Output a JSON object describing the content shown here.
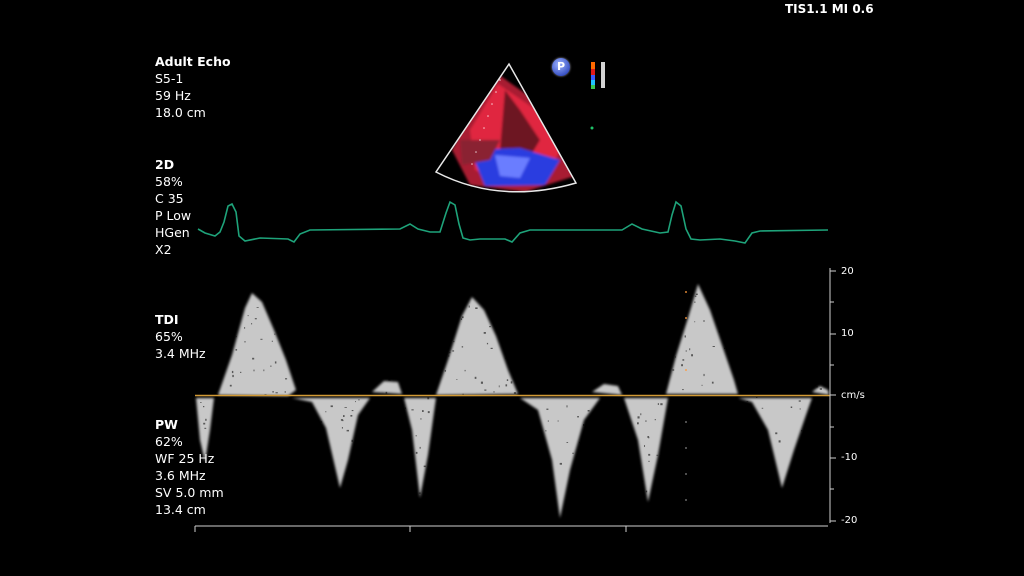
{
  "status_bar": {
    "text": "TIS1.1 MI 0.6"
  },
  "adult_echo": {
    "title": "Adult Echo",
    "lines": [
      "S5-1",
      "59 Hz",
      "18.0 cm"
    ]
  },
  "twod": {
    "title": "2D",
    "lines": [
      "58%",
      "C 35",
      "P Low",
      "HGen",
      "X2"
    ]
  },
  "tdi": {
    "title": "TDI",
    "lines": [
      "65%",
      "3.4 MHz"
    ]
  },
  "pw": {
    "title": "PW",
    "lines": [
      "62%",
      "WF 25 Hz",
      "3.6 MHz",
      "SV 5.0 mm",
      "13.4 cm"
    ]
  },
  "velocity_scale": {
    "labels": [
      "20",
      "10",
      "cm/s",
      "-10",
      "-20"
    ],
    "unit": "cm/s"
  },
  "p_badge": {
    "label": "P"
  },
  "colors": {
    "ecg": "#1ea37a",
    "baseline": "#d29a35",
    "doppler": "#d8d8d8",
    "color_flow_red": "#e0283f",
    "color_flow_blue": "#2a3de0"
  }
}
